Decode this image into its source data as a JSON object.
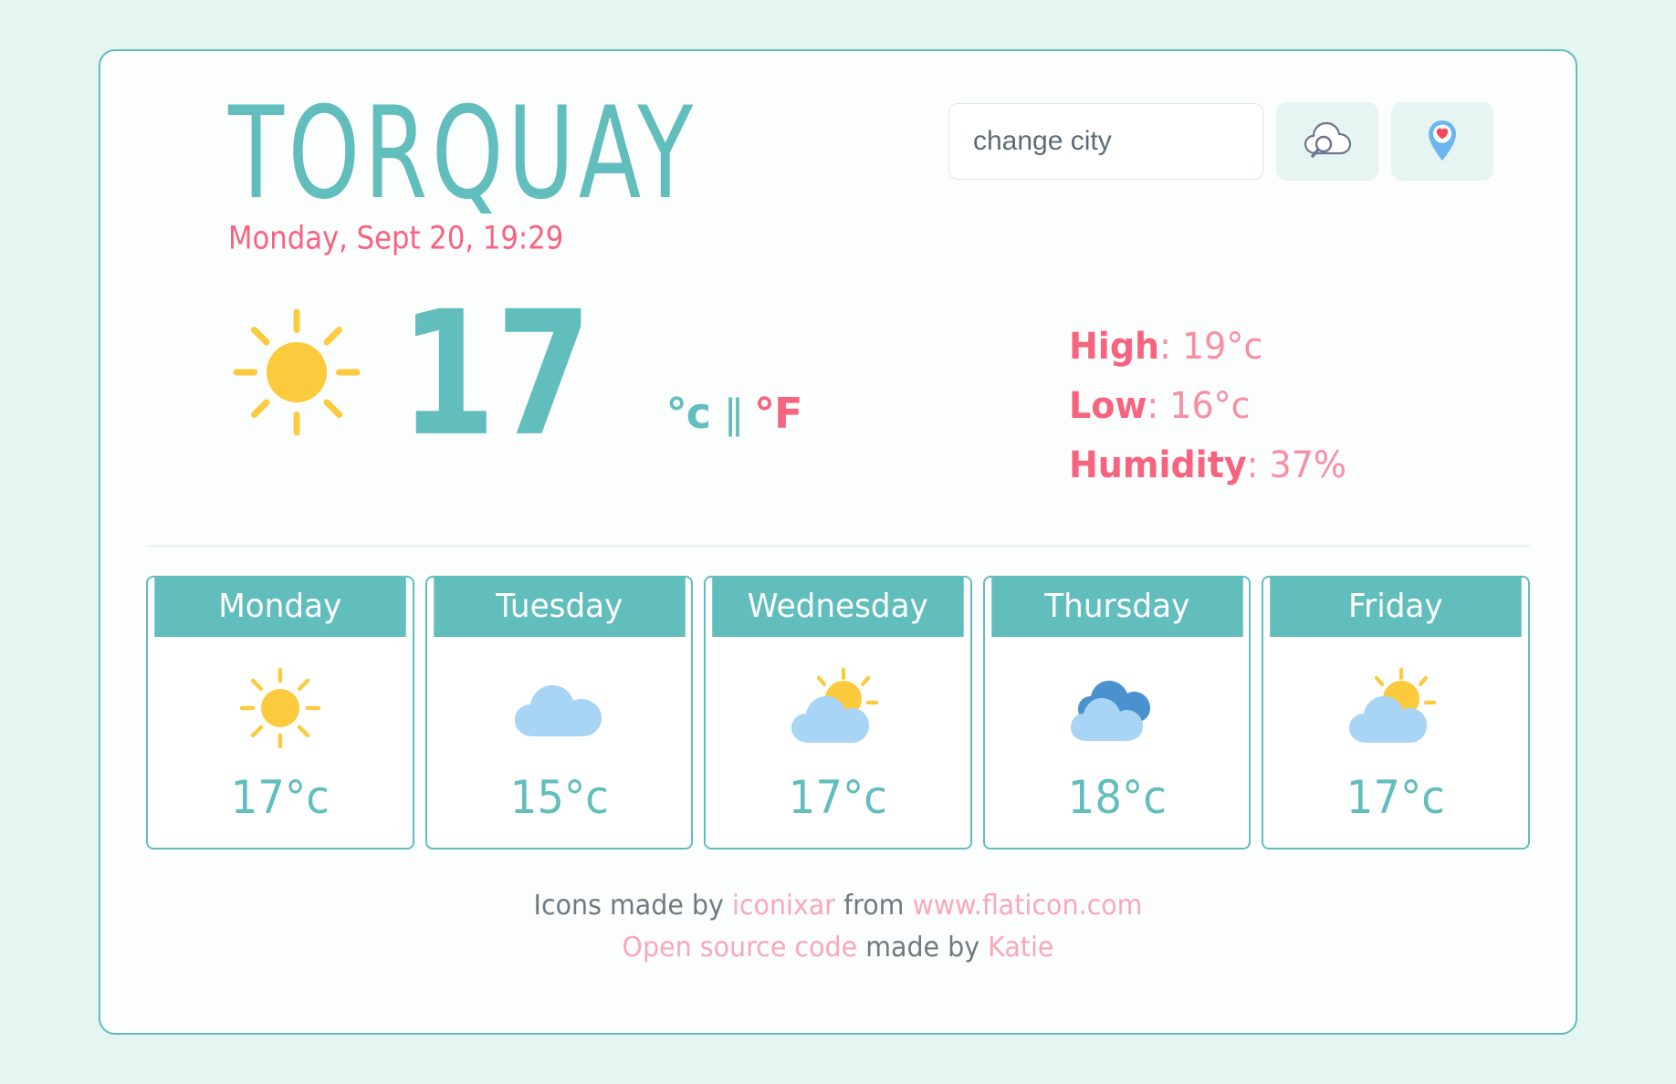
{
  "location": {
    "city": "TORQUAY",
    "datetime": "Monday, Sept 20, 19:29"
  },
  "search": {
    "placeholder": "change city",
    "value": "",
    "search_icon": "cloud-search-icon",
    "locate_icon": "location-pin-heart-icon"
  },
  "current": {
    "condition_icon": "sun-icon",
    "temperature": "17",
    "unit_celsius": "°c",
    "unit_separator": "||",
    "unit_fahrenheit": "°F",
    "active_unit": "celsius"
  },
  "stats": {
    "high_label": "High",
    "high_value": ": 19°c",
    "low_label": "Low",
    "low_value": ": 16°c",
    "humidity_label": "Humidity",
    "humidity_value": ": 37%"
  },
  "forecast": [
    {
      "day": "Monday",
      "icon": "sun-icon",
      "temp": "17°c"
    },
    {
      "day": "Tuesday",
      "icon": "cloud-icon",
      "temp": "15°c"
    },
    {
      "day": "Wednesday",
      "icon": "sun-behind-cloud-icon",
      "temp": "17°c"
    },
    {
      "day": "Thursday",
      "icon": "double-cloud-icon",
      "temp": "18°c"
    },
    {
      "day": "Friday",
      "icon": "sun-behind-cloud-icon",
      "temp": "17°c"
    }
  ],
  "footer": {
    "line1_a": "Icons made by ",
    "line1_link1": "iconixar",
    "line1_b": " from ",
    "line1_link2": "www.flaticon.com",
    "line2_link1": "Open source code",
    "line2_b": " made by ",
    "line2_link2": "Katie"
  },
  "colors": {
    "teal": "#62bdbd",
    "pink": "#f8637f",
    "pink_light": "#f78fa4",
    "yellow": "#fcca3d",
    "cloud_light": "#a8d4f5",
    "cloud_dark": "#4a91cf",
    "page_bg": "#e4f5f2"
  }
}
